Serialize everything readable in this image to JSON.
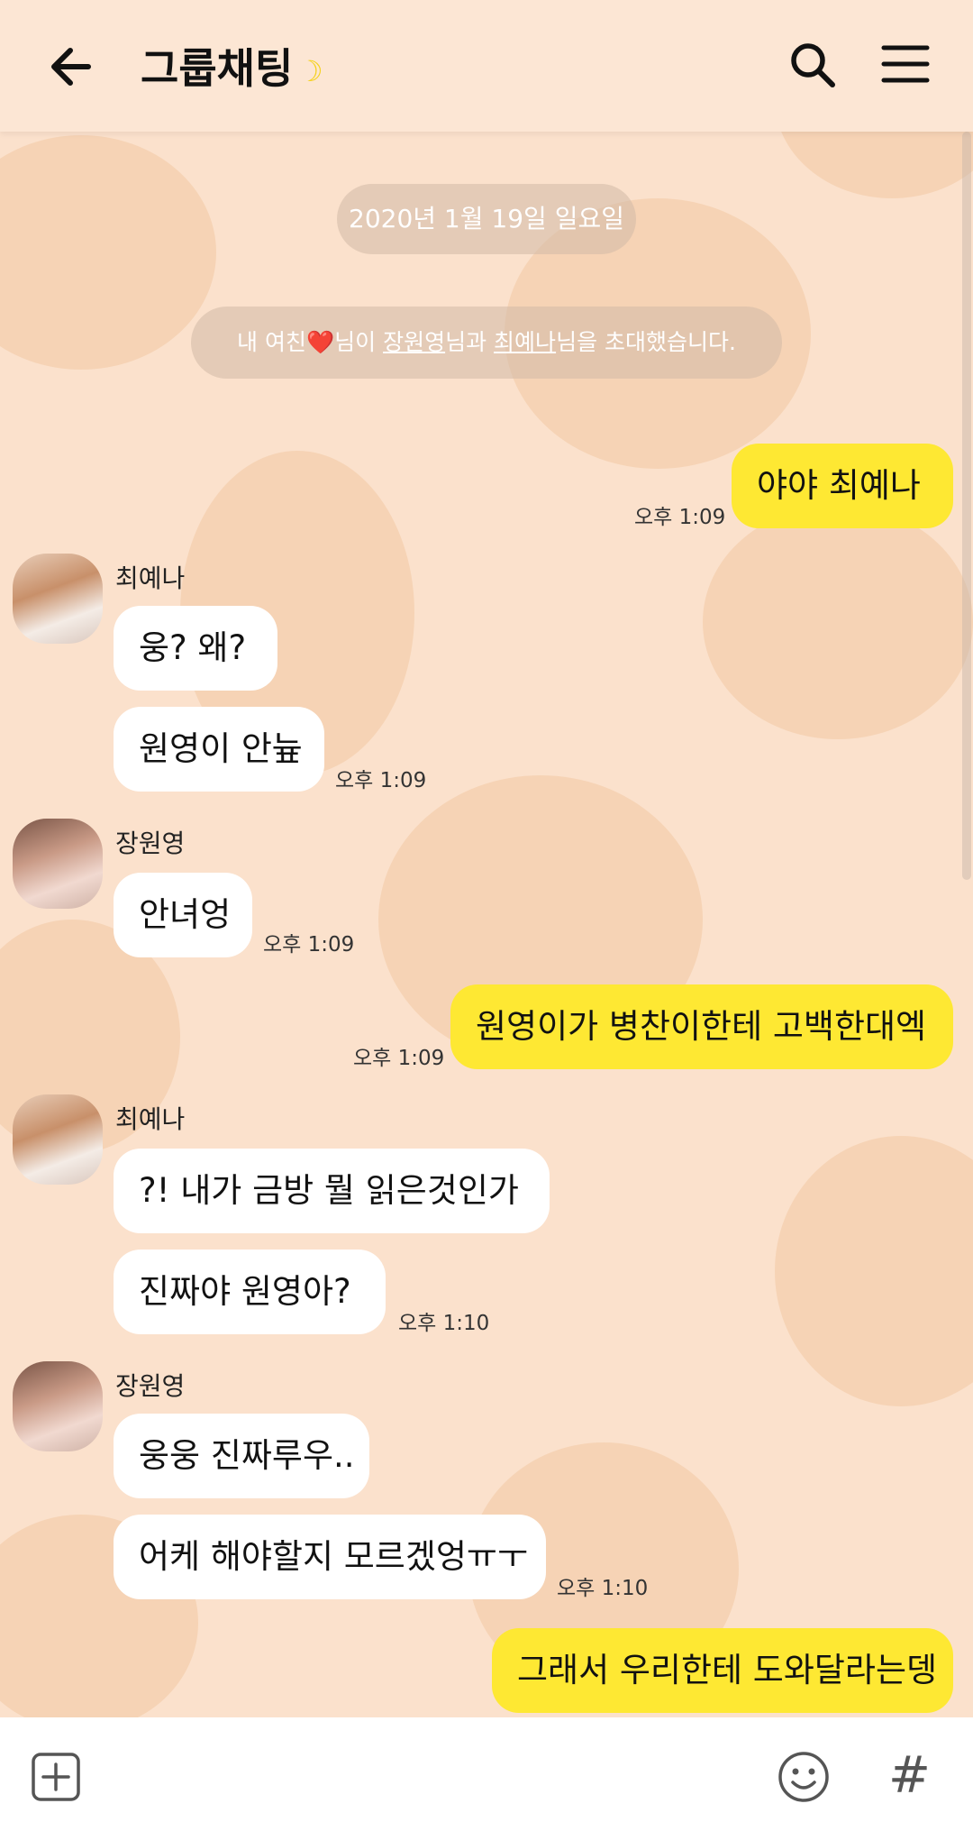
{
  "header": {
    "title": "그룹채팅",
    "title_badge": "☽"
  },
  "date_divider": "2020년 1월 19일 일요일",
  "system_message": {
    "prefix": "내 여친",
    "heart": "❤️",
    "middle1": "님이 ",
    "user1": "장원영",
    "middle2": "님과 ",
    "user2": "최예나",
    "suffix": "님을 초대했습니다."
  },
  "messages": [
    {
      "sender": "me",
      "text": "야야 최예나",
      "time": "오후 1:09"
    },
    {
      "sender": "최예나",
      "text": "웅? 왜?"
    },
    {
      "sender": "최예나",
      "text": "원영이 안늎",
      "time": "오후 1:09"
    },
    {
      "sender": "장원영",
      "text": "안녀엉",
      "time": "오후 1:09"
    },
    {
      "sender": "me",
      "text": "원영이가 병찬이한테 고백한대엑",
      "time": "오후 1:09"
    },
    {
      "sender": "최예나",
      "text": "?! 내가 금방 뭘 읽은것인가"
    },
    {
      "sender": "최예나",
      "text": "진짜야 원영아?",
      "time": "오후 1:10"
    },
    {
      "sender": "장원영",
      "text": "웅웅 진짜루우.."
    },
    {
      "sender": "장원영",
      "text": "어케 해야할지 모르겠엉ㅠㅜ",
      "time": "오후 1:10"
    },
    {
      "sender": "me",
      "text": "그래서 우리한테 도와달라는뎅"
    }
  ],
  "icons": {
    "back": "arrow-left-icon",
    "search": "search-icon",
    "menu": "hamburger-menu-icon",
    "attach": "plus-square-icon",
    "emoji": "smiley-icon",
    "hash": "hash-icon"
  },
  "hash_glyph": "#",
  "colors": {
    "my_bubble": "#fee833",
    "other_bubble": "#ffffff",
    "background": "#fbe1cc"
  }
}
